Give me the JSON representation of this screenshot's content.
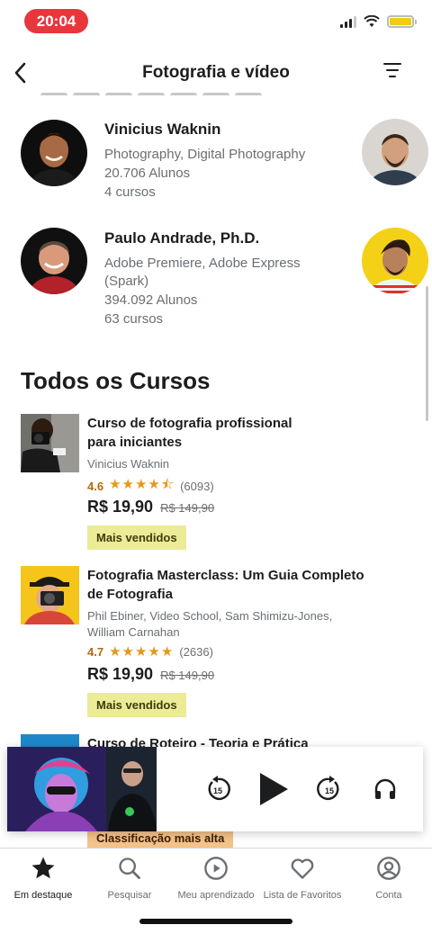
{
  "status_bar": {
    "time": "20:04"
  },
  "header": {
    "title": "Fotografia e vídeo",
    "back_icon": "chevron-left-icon",
    "filter_icon": "filter-icon"
  },
  "instructors": [
    {
      "name": "Vinicius Waknin",
      "topics": "Photography, Digital Photography",
      "students": "20.706 Alunos",
      "courses": "4 cursos"
    },
    {
      "name": "Paulo Andrade, Ph.D.",
      "topics_line1": "Adobe Premiere, Adobe Express",
      "topics_line2": "(Spark)",
      "students": "394.092 Alunos",
      "courses": "63 cursos"
    }
  ],
  "section": {
    "title": "Todos os Cursos"
  },
  "courses": [
    {
      "title_line1": "Curso de fotografia profissional",
      "title_line2": "para iniciantes",
      "author": "Vinicius Waknin",
      "rating": "4.6",
      "stars": "★★★★⯪",
      "reviews": "(6093)",
      "price": "R$ 19,90",
      "old_price": "R$ 149,90",
      "badge": "Mais vendidos"
    },
    {
      "title_line1": "Fotografia Masterclass: Um Guia Completo",
      "title_line2": "de Fotografia",
      "author_line1": "Phil Ebiner, Video School, Sam Shimizu-Jones,",
      "author_line2": "William Carnahan",
      "rating": "4.7",
      "stars": "★★★★★",
      "reviews": "(2636)",
      "price": "R$ 19,90",
      "old_price": "R$ 149,90",
      "badge": "Mais vendidos"
    },
    {
      "title_line1": "Curso de Roteiro - Teoria e Prática",
      "badge": "Classificação mais alta"
    }
  ],
  "player": {
    "rewind_label": "15",
    "forward_label": "15",
    "icons": [
      "rewind-15-icon",
      "play-icon",
      "forward-15-icon",
      "headphones-icon"
    ]
  },
  "tabs": [
    {
      "label": "Em destaque",
      "icon": "star-icon",
      "active": true
    },
    {
      "label": "Pesquisar",
      "icon": "search-icon",
      "active": false
    },
    {
      "label": "Meu aprendizado",
      "icon": "play-circle-icon",
      "active": false
    },
    {
      "label": "Lista de Favoritos",
      "icon": "heart-icon",
      "active": false
    },
    {
      "label": "Conta",
      "icon": "account-icon",
      "active": false
    }
  ],
  "colors": {
    "badge_bestseller": "#eceb98",
    "badge_top_rated": "#f5c28a",
    "rating": "#b4690e",
    "stars": "#e59819",
    "time_pill": "#e8363d"
  }
}
